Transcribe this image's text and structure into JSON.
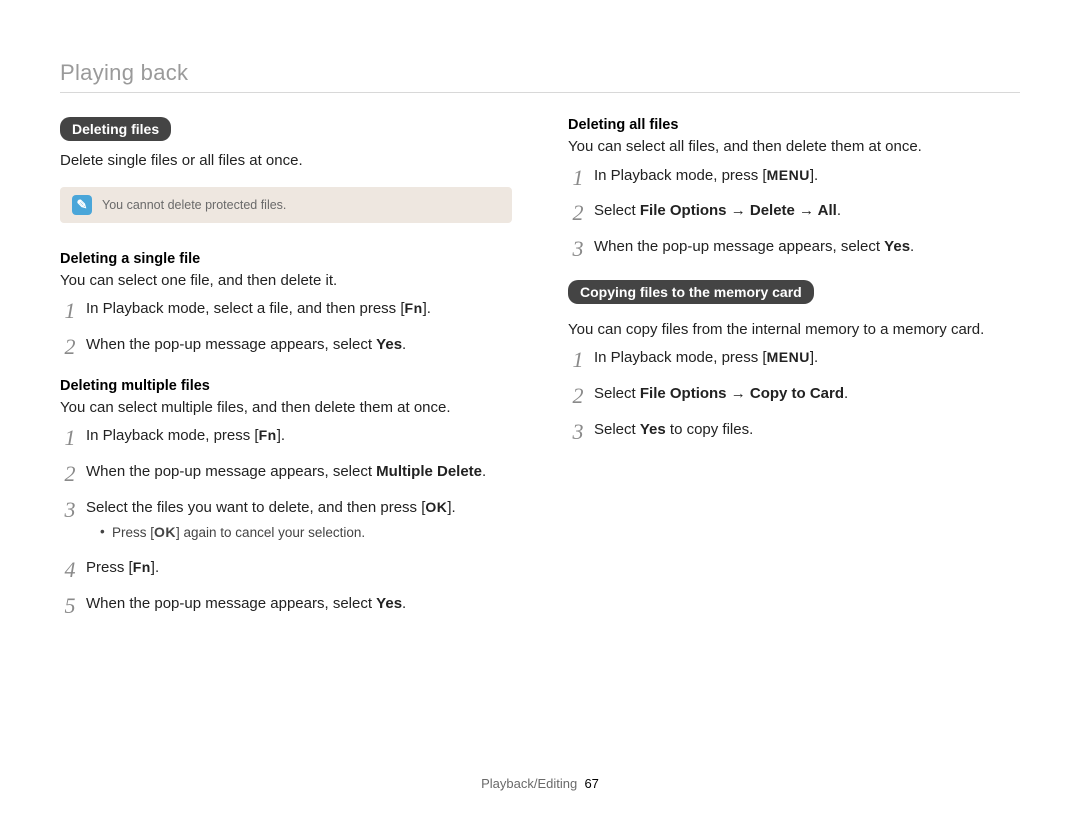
{
  "header": {
    "section": "Playing back"
  },
  "left": {
    "pill": "Deleting files",
    "intro": "Delete single files or all files at once.",
    "note": "You cannot delete protected files.",
    "single": {
      "head": "Deleting a single file",
      "desc": "You can select one file, and then delete it.",
      "steps": {
        "s1a": "In Playback mode, select a file, and then press [",
        "s1key": "Fn",
        "s1b": "].",
        "s2a": "When the pop-up message appears, select ",
        "s2bold": "Yes",
        "s2b": "."
      }
    },
    "multi": {
      "head": "Deleting multiple files",
      "desc": "You can select multiple files, and then delete them at once.",
      "steps": {
        "s1a": "In Playback mode, press [",
        "s1key": "Fn",
        "s1b": "].",
        "s2a": "When the pop-up message appears, select ",
        "s2bold": "Multiple Delete",
        "s2b": ".",
        "s3a": "Select the files you want to delete, and then press [",
        "s3key": "OK",
        "s3b": "].",
        "s3bullet_a": "Press [",
        "s3bullet_key": "OK",
        "s3bullet_b": "] again to cancel your selection.",
        "s4a": "Press [",
        "s4key": "Fn",
        "s4b": "].",
        "s5a": "When the pop-up message appears, select ",
        "s5bold": "Yes",
        "s5b": "."
      }
    }
  },
  "right": {
    "all": {
      "head": "Deleting all files",
      "desc": "You can select all files, and then delete them at once.",
      "steps": {
        "s1a": "In Playback mode, press [",
        "s1key": "MENU",
        "s1b": "].",
        "s2a": "Select ",
        "s2bold": "File Options → Delete → All",
        "s2b": ".",
        "s3a": "When the pop-up message appears, select ",
        "s3bold": "Yes",
        "s3b": "."
      }
    },
    "copy": {
      "pill": "Copying files to the memory card",
      "desc": "You can copy files from the internal memory to a memory card.",
      "steps": {
        "s1a": "In Playback mode, press [",
        "s1key": "MENU",
        "s1b": "].",
        "s2a": "Select ",
        "s2bold": "File Options → Copy to Card",
        "s2b": ".",
        "s3a": "Select ",
        "s3bold": "Yes",
        "s3b": " to copy files."
      }
    }
  },
  "footer": {
    "chapter": "Playback/Editing",
    "page": "67"
  }
}
